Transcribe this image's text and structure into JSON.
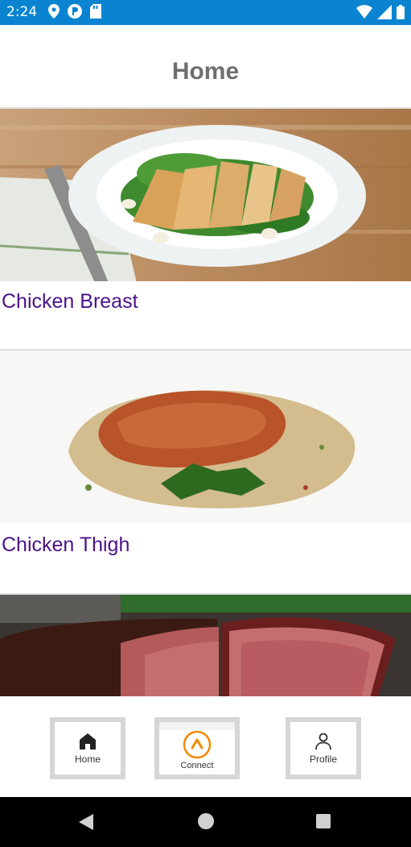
{
  "status_bar": {
    "time": "2:24",
    "left_icons": [
      "location-icon",
      "p-icon",
      "sd-card-icon"
    ],
    "right_icons": [
      "wifi-icon",
      "signal-icon",
      "battery-icon"
    ],
    "background": "#0a84d0"
  },
  "header": {
    "title": "Home"
  },
  "feed": {
    "items": [
      {
        "label": "Chicken Breast",
        "image": "chicken-breast-photo"
      },
      {
        "label": "Chicken Thigh",
        "image": "chicken-thigh-photo"
      },
      {
        "label": "",
        "image": "steak-photo"
      }
    ]
  },
  "bottom_nav": {
    "home_label": "Home",
    "connect_label": "Connect",
    "profile_label": "Profile",
    "accent": "#f08a00"
  },
  "colors": {
    "title": "#6f6f6f",
    "item_label": "#4b1289"
  }
}
